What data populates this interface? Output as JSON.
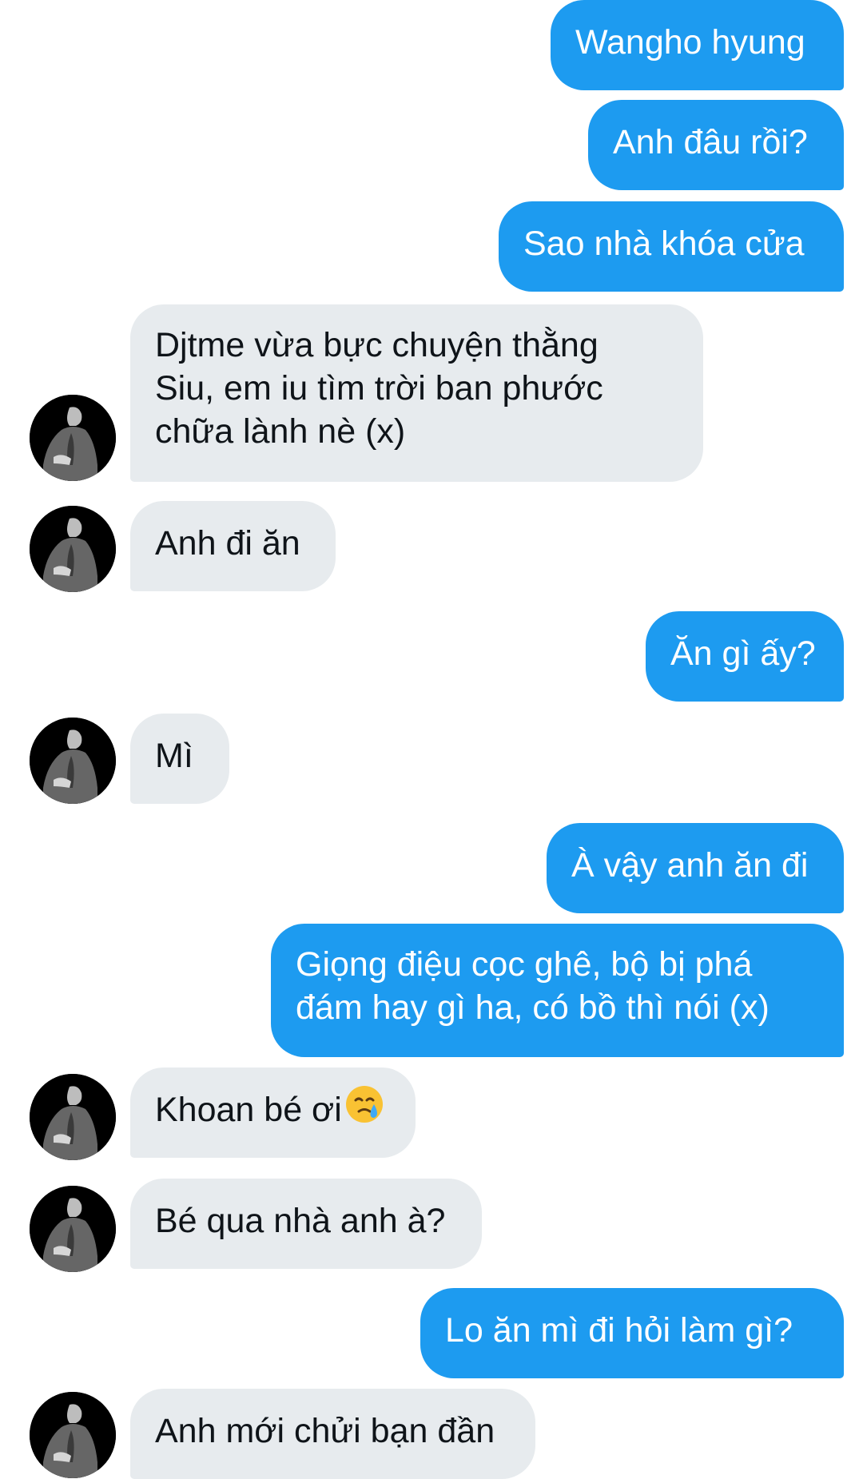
{
  "messages": [
    {
      "id": "m1",
      "side": "out",
      "lines": [
        "Wangho hyung"
      ]
    },
    {
      "id": "m2",
      "side": "out",
      "lines": [
        "Anh đâu rồi?"
      ]
    },
    {
      "id": "m3",
      "side": "out",
      "lines": [
        "Sao nhà khóa cửa"
      ]
    },
    {
      "id": "m4",
      "side": "in",
      "lines": [
        "Djtme vừa bực chuyện thằng",
        "Siu, em iu tìm trời ban phước",
        "chữa lành nè (x)"
      ]
    },
    {
      "id": "m5",
      "side": "in",
      "lines": [
        "Anh đi ăn"
      ]
    },
    {
      "id": "m6",
      "side": "out",
      "lines": [
        "Ăn gì ấy?"
      ]
    },
    {
      "id": "m7",
      "side": "in",
      "lines": [
        "Mì"
      ]
    },
    {
      "id": "m8",
      "side": "out",
      "lines": [
        "À vậy anh ăn đi"
      ]
    },
    {
      "id": "m9",
      "side": "out",
      "lines": [
        "Giọng điệu cọc ghê, bộ bị phá",
        "đám hay gì ha, có bồ thì nói (x)"
      ]
    },
    {
      "id": "m10",
      "side": "in",
      "lines": [
        "Khoan bé ơi"
      ],
      "emoji": "face-holding-back-tears-emoji"
    },
    {
      "id": "m11",
      "side": "in",
      "lines": [
        "Bé qua nhà anh à?"
      ]
    },
    {
      "id": "m12",
      "side": "out",
      "lines": [
        "Lo ăn mì đi hỏi làm gì?"
      ]
    },
    {
      "id": "m13",
      "side": "in",
      "lines": [
        "Anh mới chửi bạn đần"
      ]
    }
  ],
  "avatar": {
    "icon": "user-avatar-photo"
  },
  "colors": {
    "outgoing_bubble": "#1d9bf0",
    "incoming_bubble": "#e7ebee",
    "outgoing_text": "#ffffff",
    "incoming_text": "#0f1419"
  }
}
